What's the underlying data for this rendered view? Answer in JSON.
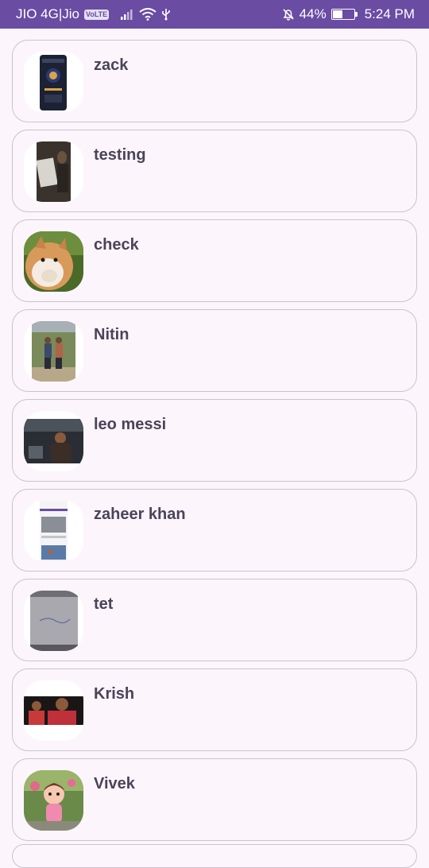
{
  "status_bar": {
    "carrier": "JIO 4G|Jio",
    "volte": "VoLTE",
    "battery_percent": "44%",
    "battery_level": 0.44,
    "time": "5:24 PM",
    "icons": [
      "signal-icon",
      "wifi-icon",
      "usb-icon",
      "bell-off-icon",
      "battery-icon"
    ]
  },
  "users": [
    {
      "name": "zack"
    },
    {
      "name": "testing"
    },
    {
      "name": "check"
    },
    {
      "name": "Nitin"
    },
    {
      "name": "leo messi"
    },
    {
      "name": "zaheer khan"
    },
    {
      "name": "tet"
    },
    {
      "name": "Krish"
    },
    {
      "name": "Vivek"
    }
  ],
  "colors": {
    "status_bar": "#6a4ca3",
    "background": "#fcf5fc",
    "card_border": "#c9c4cc",
    "name_text": "#4a4458"
  }
}
